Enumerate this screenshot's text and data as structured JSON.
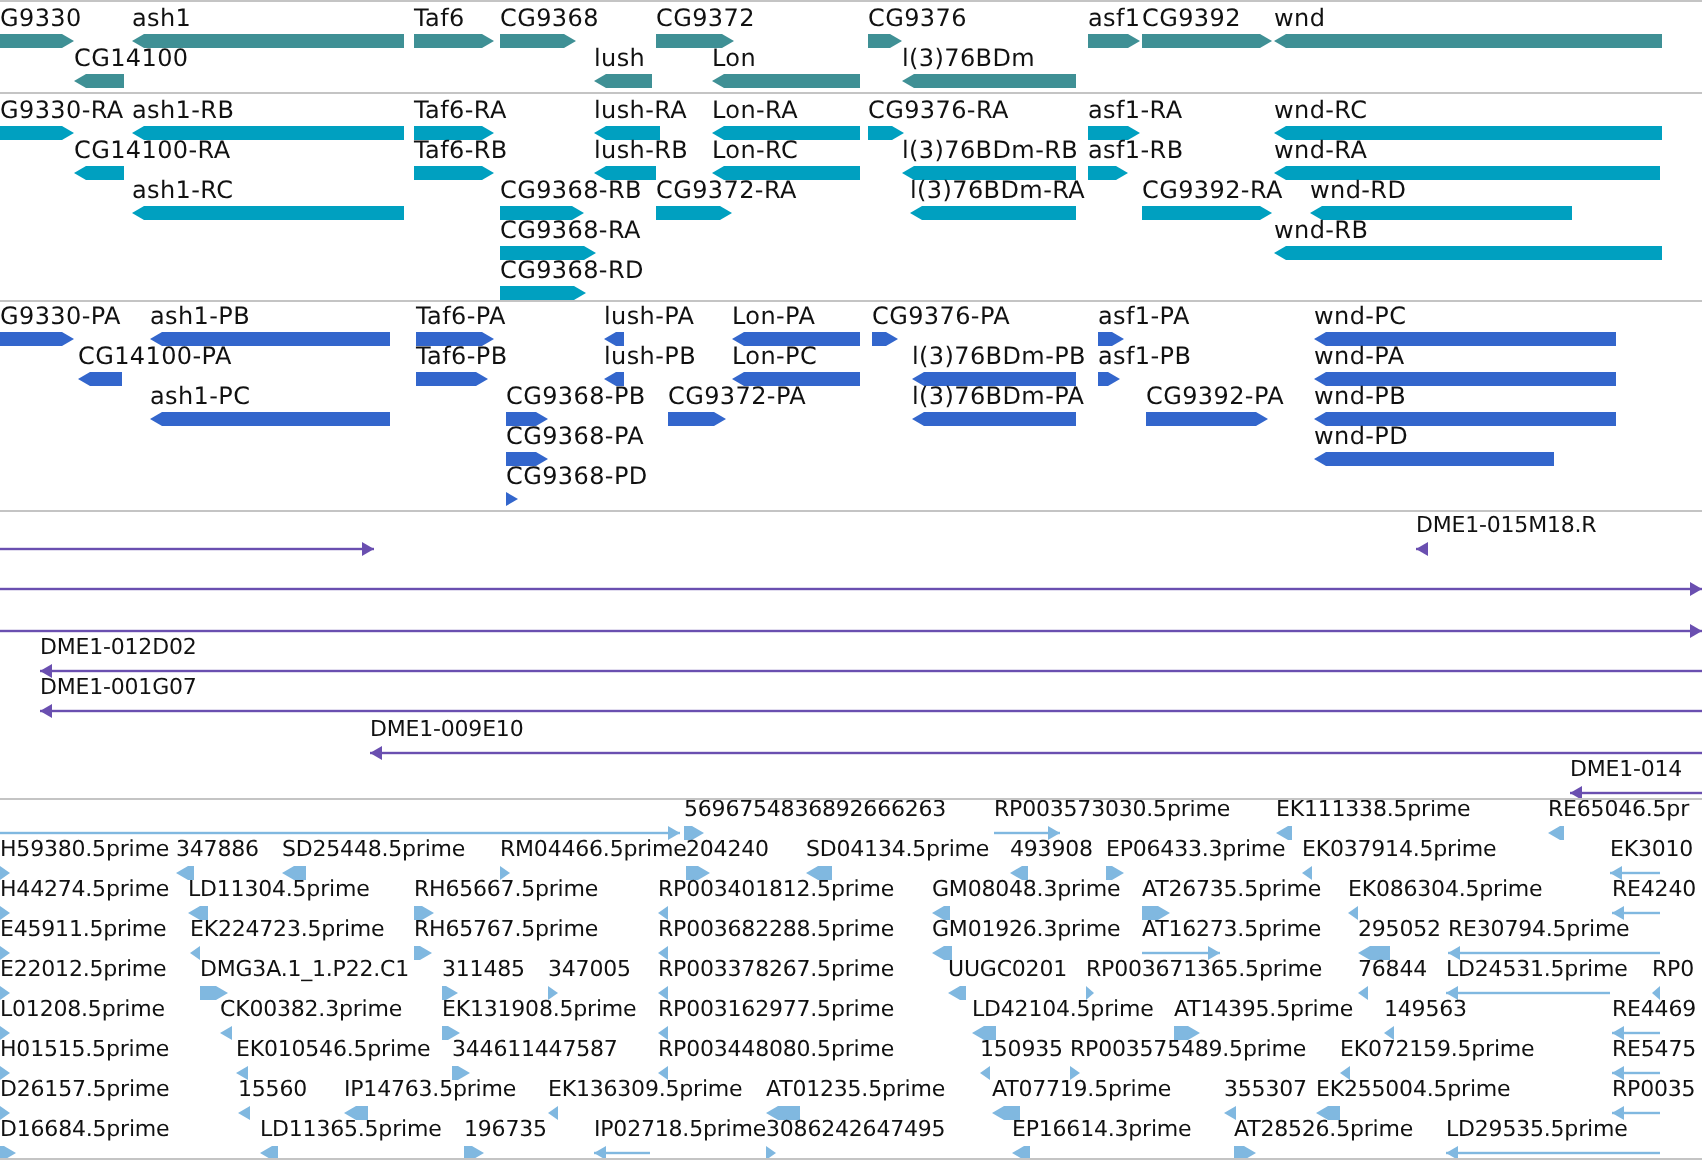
{
  "tracks": [
    {
      "kind": "gene",
      "features": [
        {
          "label": "G9330",
          "kind": "forward"
        },
        {
          "label": "ash1",
          "kind": "reverse"
        },
        {
          "label": "Taf6",
          "kind": "forward"
        },
        {
          "label": "CG9368",
          "kind": "forward"
        },
        {
          "label": "CG9372",
          "kind": "forward"
        },
        {
          "label": "CG9376",
          "kind": "forward"
        },
        {
          "label": "asf1",
          "kind": "forward"
        },
        {
          "label": "CG9392",
          "kind": "forward"
        },
        {
          "label": "wnd",
          "kind": "reverse"
        },
        {
          "label": "CG14100",
          "kind": "reverse"
        },
        {
          "label": "lush",
          "kind": "reverse"
        },
        {
          "label": "Lon",
          "kind": "reverse"
        },
        {
          "label": "l(3)76BDm",
          "kind": "reverse"
        }
      ]
    },
    {
      "kind": "transcript",
      "features": [
        {
          "label": "G9330-RA",
          "kind": "forward"
        },
        {
          "label": "ash1-RB",
          "kind": "reverse"
        },
        {
          "label": "Taf6-RA",
          "kind": "forward"
        },
        {
          "label": "lush-RA",
          "kind": "reverse"
        },
        {
          "label": "Lon-RA",
          "kind": "reverse"
        },
        {
          "label": "CG9376-RA",
          "kind": "forward"
        },
        {
          "label": "asf1-RA",
          "kind": "forward"
        },
        {
          "label": "wnd-RC",
          "kind": "reverse"
        },
        {
          "label": "CG14100-RA",
          "kind": "reverse"
        },
        {
          "label": "Taf6-RB",
          "kind": "forward"
        },
        {
          "label": "lush-RB",
          "kind": "reverse"
        },
        {
          "label": "Lon-RC",
          "kind": "reverse"
        },
        {
          "label": "l(3)76BDm-RB",
          "kind": "reverse"
        },
        {
          "label": "asf1-RB",
          "kind": "forward"
        },
        {
          "label": "wnd-RA",
          "kind": "reverse"
        },
        {
          "label": "ash1-RC",
          "kind": "reverse"
        },
        {
          "label": "CG9368-RB",
          "kind": "forward"
        },
        {
          "label": "CG9372-RA",
          "kind": "forward"
        },
        {
          "label": "l(3)76BDm-RA",
          "kind": "reverse"
        },
        {
          "label": "CG9392-RA",
          "kind": "forward"
        },
        {
          "label": "wnd-RD",
          "kind": "reverse"
        },
        {
          "label": "CG9368-RA",
          "kind": "forward"
        },
        {
          "label": "wnd-RB",
          "kind": "reverse"
        },
        {
          "label": "CG9368-RD",
          "kind": "forward"
        }
      ]
    },
    {
      "kind": "protein",
      "features": [
        {
          "label": "G9330-PA",
          "kind": "forward"
        },
        {
          "label": "ash1-PB",
          "kind": "reverse"
        },
        {
          "label": "Taf6-PA",
          "kind": "forward"
        },
        {
          "label": "lush-PA",
          "kind": "reverse"
        },
        {
          "label": "Lon-PA",
          "kind": "reverse"
        },
        {
          "label": "CG9376-PA",
          "kind": "forward"
        },
        {
          "label": "asf1-PA",
          "kind": "forward"
        },
        {
          "label": "wnd-PC",
          "kind": "reverse"
        },
        {
          "label": "CG14100-PA",
          "kind": "reverse"
        },
        {
          "label": "Taf6-PB",
          "kind": "forward"
        },
        {
          "label": "lush-PB",
          "kind": "reverse"
        },
        {
          "label": "Lon-PC",
          "kind": "reverse"
        },
        {
          "label": "l(3)76BDm-PB",
          "kind": "reverse"
        },
        {
          "label": "asf1-PB",
          "kind": "forward"
        },
        {
          "label": "wnd-PA",
          "kind": "reverse"
        },
        {
          "label": "ash1-PC",
          "kind": "reverse"
        },
        {
          "label": "CG9368-PB",
          "kind": "forward"
        },
        {
          "label": "CG9372-PA",
          "kind": "forward"
        },
        {
          "label": "l(3)76BDm-PA",
          "kind": "reverse"
        },
        {
          "label": "CG9392-PA",
          "kind": "forward"
        },
        {
          "label": "wnd-PB",
          "kind": "reverse"
        },
        {
          "label": "CG9368-PA",
          "kind": "forward"
        },
        {
          "label": "wnd-PD",
          "kind": "reverse"
        },
        {
          "label": "CG9368-PD",
          "kind": "forward"
        }
      ]
    },
    {
      "kind": "clone",
      "features": [
        {
          "kind": "forward"
        },
        {
          "label": "DME1-015M18.R",
          "kind": "reverse"
        },
        {
          "kind": "forward"
        },
        {
          "kind": "forward"
        },
        {
          "label": "DME1-012D02",
          "kind": "reverse"
        },
        {
          "label": "DME1-001G07",
          "kind": "reverse"
        },
        {
          "label": "DME1-009E10",
          "kind": "reverse"
        },
        {
          "label": "DME1-014",
          "kind": "reverse"
        }
      ]
    },
    {
      "kind": "est",
      "features": [
        {
          "kind": "forward"
        },
        {
          "label": "5696754836892666263",
          "kind": "forward"
        },
        {
          "label": "RP003573030.5prime",
          "kind": "forward"
        },
        {
          "label": "EK111338.5prime",
          "kind": "reverse"
        },
        {
          "label": "RE65046.5pr",
          "kind": "reverse"
        },
        {
          "label": "H59380.5prime",
          "kind": "forward"
        },
        {
          "label": "347886",
          "kind": "reverse"
        },
        {
          "label": "SD25448.5prime",
          "kind": "reverse"
        },
        {
          "label": "RM04466.5prime",
          "kind": "forward"
        },
        {
          "label": "204240",
          "kind": "forward"
        },
        {
          "label": "SD04134.5prime",
          "kind": "reverse"
        },
        {
          "label": "493908",
          "kind": "reverse"
        },
        {
          "label": "EP06433.3prime",
          "kind": "forward"
        },
        {
          "label": "EK037914.5prime",
          "kind": "reverse"
        },
        {
          "label": "EK3010",
          "kind": "reverse"
        },
        {
          "label": "H44274.5prime",
          "kind": "forward"
        },
        {
          "label": "LD11304.5prime",
          "kind": "reverse"
        },
        {
          "label": "RH65667.5prime",
          "kind": "forward"
        },
        {
          "label": "RP003401812.5prime",
          "kind": "reverse"
        },
        {
          "label": "GM08048.3prime",
          "kind": "reverse"
        },
        {
          "label": "AT26735.5prime",
          "kind": "forward"
        },
        {
          "label": "EK086304.5prime",
          "kind": "reverse"
        },
        {
          "label": "RE4240",
          "kind": "reverse"
        },
        {
          "label": "E45911.5prime",
          "kind": "forward"
        },
        {
          "label": "EK224723.5prime",
          "kind": "reverse"
        },
        {
          "label": "RH65767.5prime",
          "kind": "forward"
        },
        {
          "label": "RP003682288.5prime",
          "kind": "reverse"
        },
        {
          "label": "GM01926.3prime",
          "kind": "reverse"
        },
        {
          "label": "AT16273.5prime",
          "kind": "forward"
        },
        {
          "label": "295052",
          "kind": "reverse"
        },
        {
          "label": "RE30794.5prime",
          "kind": "reverse"
        },
        {
          "label": "E22012.5prime",
          "kind": "forward"
        },
        {
          "label": "DMG3A.1_1.P22.C1",
          "kind": "forward"
        },
        {
          "label": "311485",
          "kind": "forward"
        },
        {
          "label": "347005",
          "kind": "forward"
        },
        {
          "label": "RP003378267.5prime",
          "kind": "reverse"
        },
        {
          "label": "UUGC0201",
          "kind": "reverse"
        },
        {
          "label": "RP003671365.5prime",
          "kind": "forward"
        },
        {
          "label": "76844",
          "kind": "reverse"
        },
        {
          "label": "LD24531.5prime",
          "kind": "reverse"
        },
        {
          "label": "RP0",
          "kind": "reverse"
        },
        {
          "label": "L01208.5prime",
          "kind": "forward"
        },
        {
          "label": "CK00382.3prime",
          "kind": "reverse"
        },
        {
          "label": "EK131908.5prime",
          "kind": "forward"
        },
        {
          "label": "RP003162977.5prime",
          "kind": "reverse"
        },
        {
          "label": "LD42104.5prime",
          "kind": "reverse"
        },
        {
          "label": "AT14395.5prime",
          "kind": "forward"
        },
        {
          "label": "149563",
          "kind": "reverse"
        },
        {
          "label": "RE4469",
          "kind": "reverse"
        },
        {
          "label": "H01515.5prime",
          "kind": "forward"
        },
        {
          "label": "EK010546.5prime",
          "kind": "reverse"
        },
        {
          "label": "344611447587",
          "kind": "forward"
        },
        {
          "label": "RP003448080.5prime",
          "kind": "reverse"
        },
        {
          "label": "150935",
          "kind": "reverse"
        },
        {
          "label": "RP003575489.5prime",
          "kind": "forward"
        },
        {
          "label": "EK072159.5prime",
          "kind": "reverse"
        },
        {
          "label": "RE5475",
          "kind": "reverse"
        },
        {
          "label": "D26157.5prime",
          "kind": "forward"
        },
        {
          "label": "15560",
          "kind": "reverse"
        },
        {
          "label": "IP14763.5prime",
          "kind": "reverse"
        },
        {
          "label": "EK136309.5prime",
          "kind": "reverse"
        },
        {
          "label": "AT01235.5prime",
          "kind": "reverse"
        },
        {
          "label": "AT07719.5prime",
          "kind": "reverse"
        },
        {
          "label": "355307",
          "kind": "reverse"
        },
        {
          "label": "EK255004.5prime",
          "kind": "reverse"
        },
        {
          "label": "RP0035",
          "kind": "reverse"
        },
        {
          "label": "D16684.5prime",
          "kind": "forward"
        },
        {
          "label": "LD11365.5prime",
          "kind": "reverse"
        },
        {
          "label": "196735",
          "kind": "forward"
        },
        {
          "label": "IP02718.5prime",
          "kind": "reverse"
        },
        {
          "label": "3086242647495",
          "kind": "forward"
        },
        {
          "label": "EP16614.3prime",
          "kind": "reverse"
        },
        {
          "label": "AT28526.5prime",
          "kind": "forward"
        },
        {
          "label": "LD29535.5prime",
          "kind": "reverse"
        }
      ]
    }
  ]
}
